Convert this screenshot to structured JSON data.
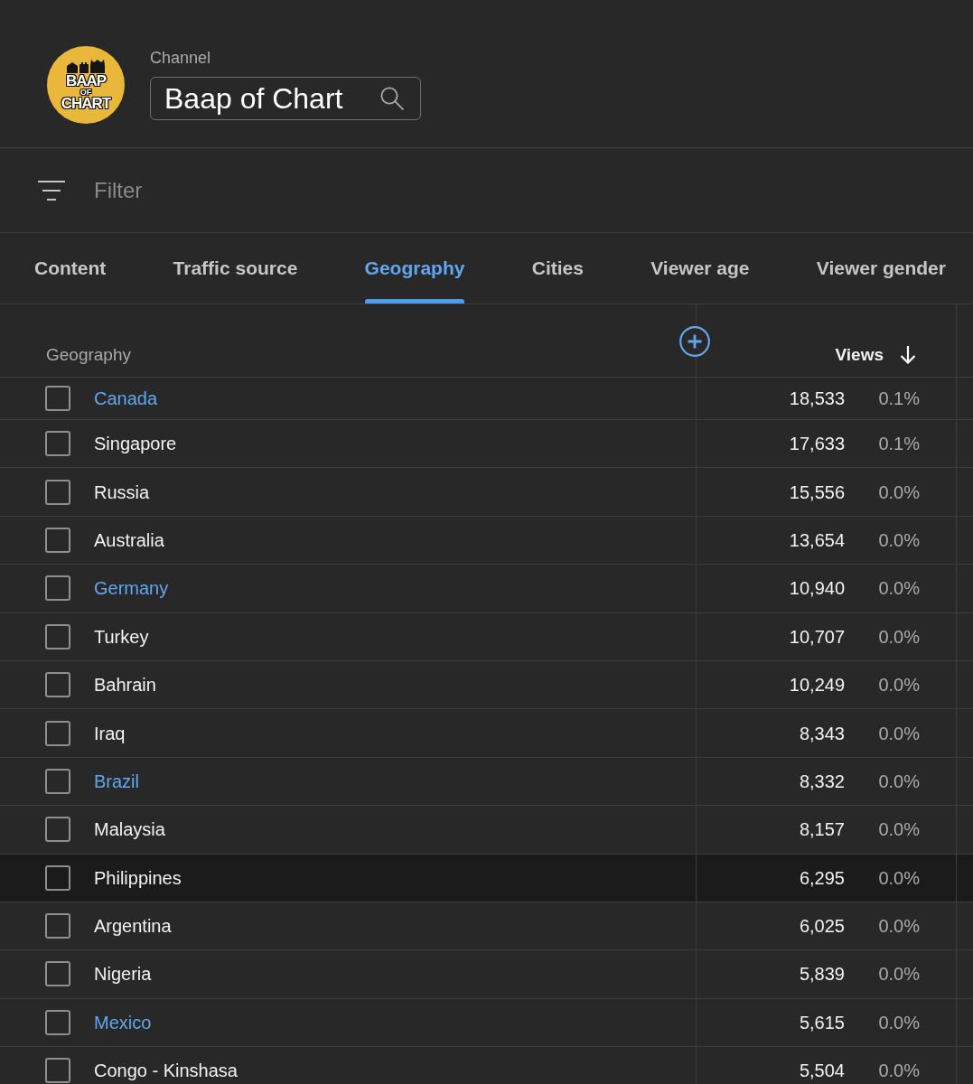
{
  "channel": {
    "logo_text": [
      {
        "text": "BAAP",
        "kind": "large"
      },
      {
        "text": "OF",
        "kind": "small"
      },
      {
        "text": "CHART",
        "kind": "large"
      }
    ],
    "label": "Channel",
    "name": "Baap of Chart"
  },
  "filter": {
    "placeholder": "Filter"
  },
  "tabs": [
    {
      "label": "Content",
      "selected": false
    },
    {
      "label": "Traffic source",
      "selected": false
    },
    {
      "label": "Geography",
      "selected": true
    },
    {
      "label": "Cities",
      "selected": false
    },
    {
      "label": "Viewer age",
      "selected": false
    },
    {
      "label": "Viewer gender",
      "selected": false
    }
  ],
  "table": {
    "columns": [
      {
        "label": "Geography",
        "sorted": false
      },
      {
        "label": "Views",
        "sorted": true
      }
    ],
    "rows": [
      {
        "name": "Canada",
        "linked": true,
        "hovered": false,
        "checked": false,
        "views": "18,533",
        "share": "0.1%"
      },
      {
        "name": "Singapore",
        "linked": false,
        "hovered": false,
        "checked": false,
        "views": "17,633",
        "share": "0.1%"
      },
      {
        "name": "Russia",
        "linked": false,
        "hovered": false,
        "checked": false,
        "views": "15,556",
        "share": "0.0%"
      },
      {
        "name": "Australia",
        "linked": false,
        "hovered": false,
        "checked": false,
        "views": "13,654",
        "share": "0.0%"
      },
      {
        "name": "Germany",
        "linked": true,
        "hovered": false,
        "checked": false,
        "views": "10,940",
        "share": "0.0%"
      },
      {
        "name": "Turkey",
        "linked": false,
        "hovered": false,
        "checked": false,
        "views": "10,707",
        "share": "0.0%"
      },
      {
        "name": "Bahrain",
        "linked": false,
        "hovered": false,
        "checked": false,
        "views": "10,249",
        "share": "0.0%"
      },
      {
        "name": "Iraq",
        "linked": false,
        "hovered": false,
        "checked": false,
        "views": "8,343",
        "share": "0.0%"
      },
      {
        "name": "Brazil",
        "linked": true,
        "hovered": false,
        "checked": false,
        "views": "8,332",
        "share": "0.0%"
      },
      {
        "name": "Malaysia",
        "linked": false,
        "hovered": false,
        "checked": false,
        "views": "8,157",
        "share": "0.0%"
      },
      {
        "name": "Philippines",
        "linked": false,
        "hovered": true,
        "checked": false,
        "views": "6,295",
        "share": "0.0%"
      },
      {
        "name": "Argentina",
        "linked": false,
        "hovered": false,
        "checked": false,
        "views": "6,025",
        "share": "0.0%"
      },
      {
        "name": "Nigeria",
        "linked": false,
        "hovered": false,
        "checked": false,
        "views": "5,839",
        "share": "0.0%"
      },
      {
        "name": "Mexico",
        "linked": true,
        "hovered": false,
        "checked": false,
        "views": "5,615",
        "share": "0.0%"
      },
      {
        "name": "Congo - Kinshasa",
        "linked": false,
        "hovered": false,
        "checked": false,
        "views": "5,504",
        "share": "0.0%"
      }
    ]
  }
}
